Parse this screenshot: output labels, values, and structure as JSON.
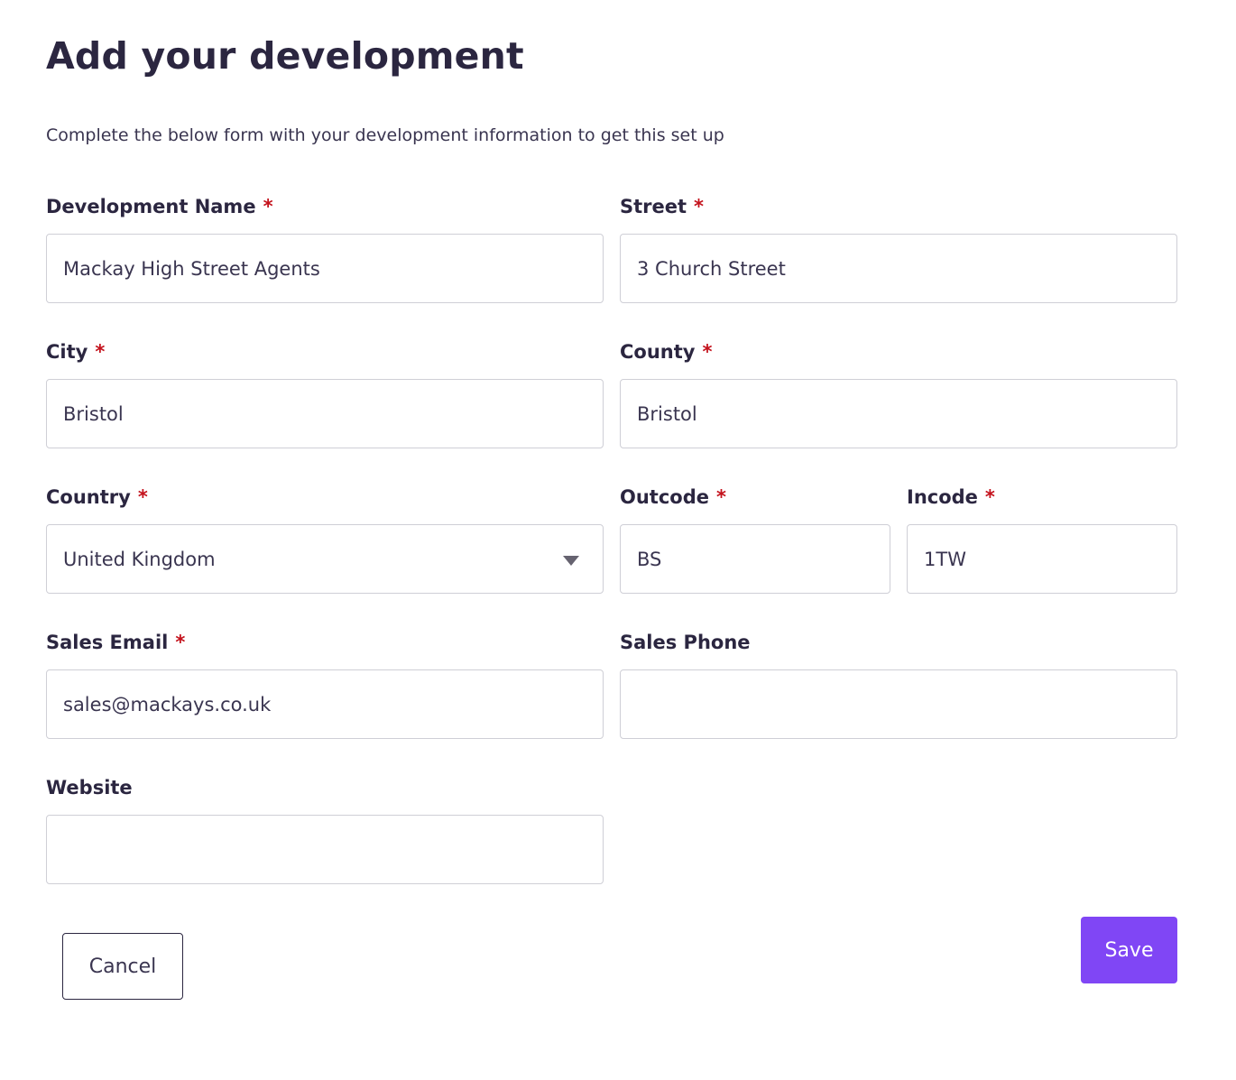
{
  "header": {
    "title": "Add your development",
    "subtitle": "Complete the below form with your development information to get this set up"
  },
  "form": {
    "required_marker": "*",
    "development_name": {
      "label": "Development Name",
      "value": "Mackay High Street Agents"
    },
    "street": {
      "label": "Street",
      "value": "3 Church Street"
    },
    "city": {
      "label": "City",
      "value": "Bristol"
    },
    "county": {
      "label": "County",
      "value": "Bristol"
    },
    "country": {
      "label": "Country",
      "value": "United Kingdom"
    },
    "outcode": {
      "label": "Outcode",
      "value": "BS"
    },
    "incode": {
      "label": "Incode",
      "value": "1TW"
    },
    "sales_email": {
      "label": "Sales Email",
      "value": "sales@mackays.co.uk"
    },
    "sales_phone": {
      "label": "Sales Phone",
      "value": ""
    },
    "website": {
      "label": "Website",
      "value": ""
    }
  },
  "actions": {
    "cancel_label": "Cancel",
    "save_label": "Save"
  },
  "colors": {
    "primary": "#8046f5",
    "required": "#c4121c",
    "text": "#2b2640",
    "border": "#cfcfd6"
  },
  "icons": {
    "country_select": "chevron-down-icon"
  }
}
